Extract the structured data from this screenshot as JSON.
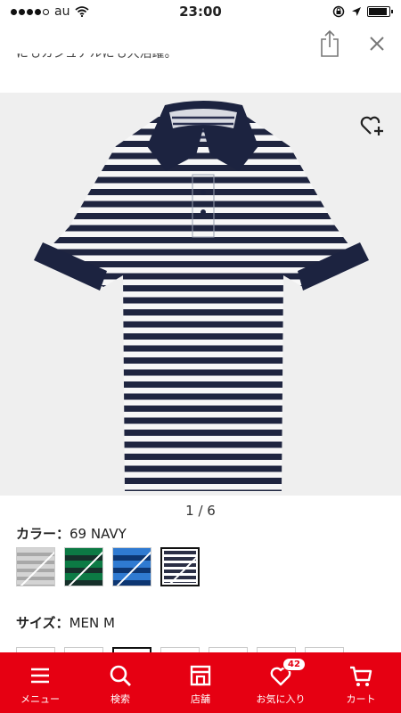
{
  "status_bar": {
    "carrier": "au",
    "time": "23:00"
  },
  "description_snippet": "にもカジュアルにも大活躍。",
  "pager": "1 / 6",
  "color": {
    "label": "カラー：",
    "value": "69 NAVY"
  },
  "swatches": [
    {
      "name": "gray",
      "stripe_a": "#cfcfcf",
      "stripe_b": "#a9a9a9"
    },
    {
      "name": "green",
      "stripe_a": "#0c6b3f",
      "stripe_b": "#143a2b"
    },
    {
      "name": "blue",
      "stripe_a": "#2a73c9",
      "stripe_b": "#0e3c7a"
    },
    {
      "name": "navy",
      "stripe_a": "#2b2f45",
      "stripe_b": "#ffffff"
    }
  ],
  "size": {
    "label": "サイズ：",
    "value": "MEN  M"
  },
  "tabs": [
    {
      "label": "メニュー",
      "icon": "menu-icon"
    },
    {
      "label": "検索",
      "icon": "search-icon"
    },
    {
      "label": "店舗",
      "icon": "store-icon"
    },
    {
      "label": "お気に入り",
      "icon": "heart-icon",
      "badge": "42"
    },
    {
      "label": "カート",
      "icon": "cart-icon"
    }
  ],
  "colors": {
    "accent": "#e60012",
    "navy": "#1c2340"
  }
}
